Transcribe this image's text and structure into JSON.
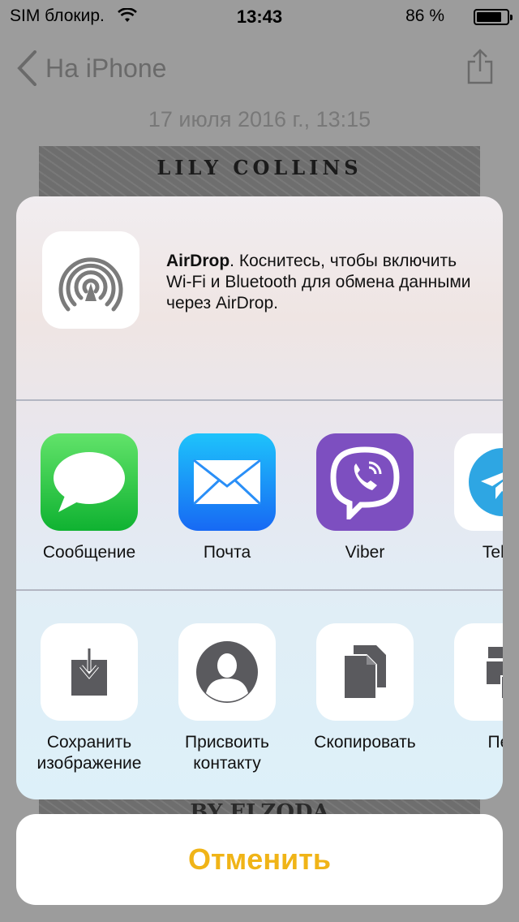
{
  "status_bar": {
    "carrier": "SIM блокир.",
    "time": "13:43",
    "battery": "86 %",
    "battery_level": 0.86
  },
  "nav": {
    "back_label": "На iPhone"
  },
  "photo": {
    "date": "17 июля 2016 г., 13:15",
    "title_text": "LILY COLLINS",
    "bottom_text": "BY ELZODA"
  },
  "share_sheet": {
    "airdrop": {
      "bold": "AirDrop",
      "text": ". Коснитесь, чтобы включить Wi-Fi и Bluetooth для обмена данными через AirDrop.",
      "icon": "airdrop-icon"
    },
    "apps": [
      {
        "label": "Сообщение",
        "icon": "messages-icon",
        "color": "#34c84a"
      },
      {
        "label": "Почта",
        "icon": "mail-icon",
        "color": "#1d8cf8"
      },
      {
        "label": "Viber",
        "icon": "viber-icon",
        "color": "#7d4fc0"
      },
      {
        "label": "Teleg",
        "icon": "telegram-icon",
        "color": "#2ea6e3"
      }
    ],
    "actions": [
      {
        "label": "Сохранить изображение",
        "icon": "save-image-icon"
      },
      {
        "label": "Присвоить контакту",
        "icon": "assign-contact-icon"
      },
      {
        "label": "Скопировать",
        "icon": "copy-icon"
      },
      {
        "label": "Печ",
        "icon": "print-icon"
      }
    ]
  },
  "cancel_label": "Отменить",
  "colors": {
    "accent": "#f0b417"
  }
}
